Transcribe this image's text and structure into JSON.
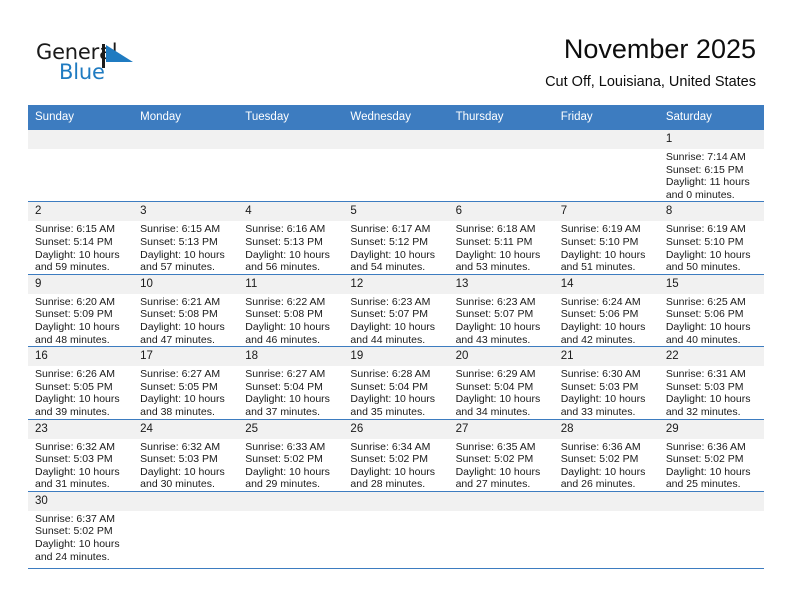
{
  "brand": {
    "name_part1": "General",
    "name_part2": "Blue",
    "logo_icon": "blue-flag-triangle-icon",
    "color_dark": "#1a1a1a",
    "color_blue": "#1f7bc1"
  },
  "header": {
    "title": "November 2025",
    "subtitle": "Cut Off, Louisiana, United States"
  },
  "theme": {
    "header_row_bg": "#3d7cc0",
    "day_band_bg": "#f1f1f1",
    "grid_line": "#3d7cc0",
    "text": "#1a1a1a"
  },
  "weekday_headers": [
    "Sunday",
    "Monday",
    "Tuesday",
    "Wednesday",
    "Thursday",
    "Friday",
    "Saturday"
  ],
  "weeks": [
    [
      {
        "day": "",
        "empty": true
      },
      {
        "day": "",
        "empty": true
      },
      {
        "day": "",
        "empty": true
      },
      {
        "day": "",
        "empty": true
      },
      {
        "day": "",
        "empty": true
      },
      {
        "day": "",
        "empty": true
      },
      {
        "day": "1",
        "sunrise": "Sunrise: 7:14 AM",
        "sunset": "Sunset: 6:15 PM",
        "daylight1": "Daylight: 11 hours",
        "daylight2": "and 0 minutes."
      }
    ],
    [
      {
        "day": "2",
        "sunrise": "Sunrise: 6:15 AM",
        "sunset": "Sunset: 5:14 PM",
        "daylight1": "Daylight: 10 hours",
        "daylight2": "and 59 minutes."
      },
      {
        "day": "3",
        "sunrise": "Sunrise: 6:15 AM",
        "sunset": "Sunset: 5:13 PM",
        "daylight1": "Daylight: 10 hours",
        "daylight2": "and 57 minutes."
      },
      {
        "day": "4",
        "sunrise": "Sunrise: 6:16 AM",
        "sunset": "Sunset: 5:13 PM",
        "daylight1": "Daylight: 10 hours",
        "daylight2": "and 56 minutes."
      },
      {
        "day": "5",
        "sunrise": "Sunrise: 6:17 AM",
        "sunset": "Sunset: 5:12 PM",
        "daylight1": "Daylight: 10 hours",
        "daylight2": "and 54 minutes."
      },
      {
        "day": "6",
        "sunrise": "Sunrise: 6:18 AM",
        "sunset": "Sunset: 5:11 PM",
        "daylight1": "Daylight: 10 hours",
        "daylight2": "and 53 minutes."
      },
      {
        "day": "7",
        "sunrise": "Sunrise: 6:19 AM",
        "sunset": "Sunset: 5:10 PM",
        "daylight1": "Daylight: 10 hours",
        "daylight2": "and 51 minutes."
      },
      {
        "day": "8",
        "sunrise": "Sunrise: 6:19 AM",
        "sunset": "Sunset: 5:10 PM",
        "daylight1": "Daylight: 10 hours",
        "daylight2": "and 50 minutes."
      }
    ],
    [
      {
        "day": "9",
        "sunrise": "Sunrise: 6:20 AM",
        "sunset": "Sunset: 5:09 PM",
        "daylight1": "Daylight: 10 hours",
        "daylight2": "and 48 minutes."
      },
      {
        "day": "10",
        "sunrise": "Sunrise: 6:21 AM",
        "sunset": "Sunset: 5:08 PM",
        "daylight1": "Daylight: 10 hours",
        "daylight2": "and 47 minutes."
      },
      {
        "day": "11",
        "sunrise": "Sunrise: 6:22 AM",
        "sunset": "Sunset: 5:08 PM",
        "daylight1": "Daylight: 10 hours",
        "daylight2": "and 46 minutes."
      },
      {
        "day": "12",
        "sunrise": "Sunrise: 6:23 AM",
        "sunset": "Sunset: 5:07 PM",
        "daylight1": "Daylight: 10 hours",
        "daylight2": "and 44 minutes."
      },
      {
        "day": "13",
        "sunrise": "Sunrise: 6:23 AM",
        "sunset": "Sunset: 5:07 PM",
        "daylight1": "Daylight: 10 hours",
        "daylight2": "and 43 minutes."
      },
      {
        "day": "14",
        "sunrise": "Sunrise: 6:24 AM",
        "sunset": "Sunset: 5:06 PM",
        "daylight1": "Daylight: 10 hours",
        "daylight2": "and 42 minutes."
      },
      {
        "day": "15",
        "sunrise": "Sunrise: 6:25 AM",
        "sunset": "Sunset: 5:06 PM",
        "daylight1": "Daylight: 10 hours",
        "daylight2": "and 40 minutes."
      }
    ],
    [
      {
        "day": "16",
        "sunrise": "Sunrise: 6:26 AM",
        "sunset": "Sunset: 5:05 PM",
        "daylight1": "Daylight: 10 hours",
        "daylight2": "and 39 minutes."
      },
      {
        "day": "17",
        "sunrise": "Sunrise: 6:27 AM",
        "sunset": "Sunset: 5:05 PM",
        "daylight1": "Daylight: 10 hours",
        "daylight2": "and 38 minutes."
      },
      {
        "day": "18",
        "sunrise": "Sunrise: 6:27 AM",
        "sunset": "Sunset: 5:04 PM",
        "daylight1": "Daylight: 10 hours",
        "daylight2": "and 37 minutes."
      },
      {
        "day": "19",
        "sunrise": "Sunrise: 6:28 AM",
        "sunset": "Sunset: 5:04 PM",
        "daylight1": "Daylight: 10 hours",
        "daylight2": "and 35 minutes."
      },
      {
        "day": "20",
        "sunrise": "Sunrise: 6:29 AM",
        "sunset": "Sunset: 5:04 PM",
        "daylight1": "Daylight: 10 hours",
        "daylight2": "and 34 minutes."
      },
      {
        "day": "21",
        "sunrise": "Sunrise: 6:30 AM",
        "sunset": "Sunset: 5:03 PM",
        "daylight1": "Daylight: 10 hours",
        "daylight2": "and 33 minutes."
      },
      {
        "day": "22",
        "sunrise": "Sunrise: 6:31 AM",
        "sunset": "Sunset: 5:03 PM",
        "daylight1": "Daylight: 10 hours",
        "daylight2": "and 32 minutes."
      }
    ],
    [
      {
        "day": "23",
        "sunrise": "Sunrise: 6:32 AM",
        "sunset": "Sunset: 5:03 PM",
        "daylight1": "Daylight: 10 hours",
        "daylight2": "and 31 minutes."
      },
      {
        "day": "24",
        "sunrise": "Sunrise: 6:32 AM",
        "sunset": "Sunset: 5:03 PM",
        "daylight1": "Daylight: 10 hours",
        "daylight2": "and 30 minutes."
      },
      {
        "day": "25",
        "sunrise": "Sunrise: 6:33 AM",
        "sunset": "Sunset: 5:02 PM",
        "daylight1": "Daylight: 10 hours",
        "daylight2": "and 29 minutes."
      },
      {
        "day": "26",
        "sunrise": "Sunrise: 6:34 AM",
        "sunset": "Sunset: 5:02 PM",
        "daylight1": "Daylight: 10 hours",
        "daylight2": "and 28 minutes."
      },
      {
        "day": "27",
        "sunrise": "Sunrise: 6:35 AM",
        "sunset": "Sunset: 5:02 PM",
        "daylight1": "Daylight: 10 hours",
        "daylight2": "and 27 minutes."
      },
      {
        "day": "28",
        "sunrise": "Sunrise: 6:36 AM",
        "sunset": "Sunset: 5:02 PM",
        "daylight1": "Daylight: 10 hours",
        "daylight2": "and 26 minutes."
      },
      {
        "day": "29",
        "sunrise": "Sunrise: 6:36 AM",
        "sunset": "Sunset: 5:02 PM",
        "daylight1": "Daylight: 10 hours",
        "daylight2": "and 25 minutes."
      }
    ],
    [
      {
        "day": "30",
        "sunrise": "Sunrise: 6:37 AM",
        "sunset": "Sunset: 5:02 PM",
        "daylight1": "Daylight: 10 hours",
        "daylight2": "and 24 minutes."
      },
      {
        "day": "",
        "empty": true
      },
      {
        "day": "",
        "empty": true
      },
      {
        "day": "",
        "empty": true
      },
      {
        "day": "",
        "empty": true
      },
      {
        "day": "",
        "empty": true
      },
      {
        "day": "",
        "empty": true
      }
    ]
  ]
}
